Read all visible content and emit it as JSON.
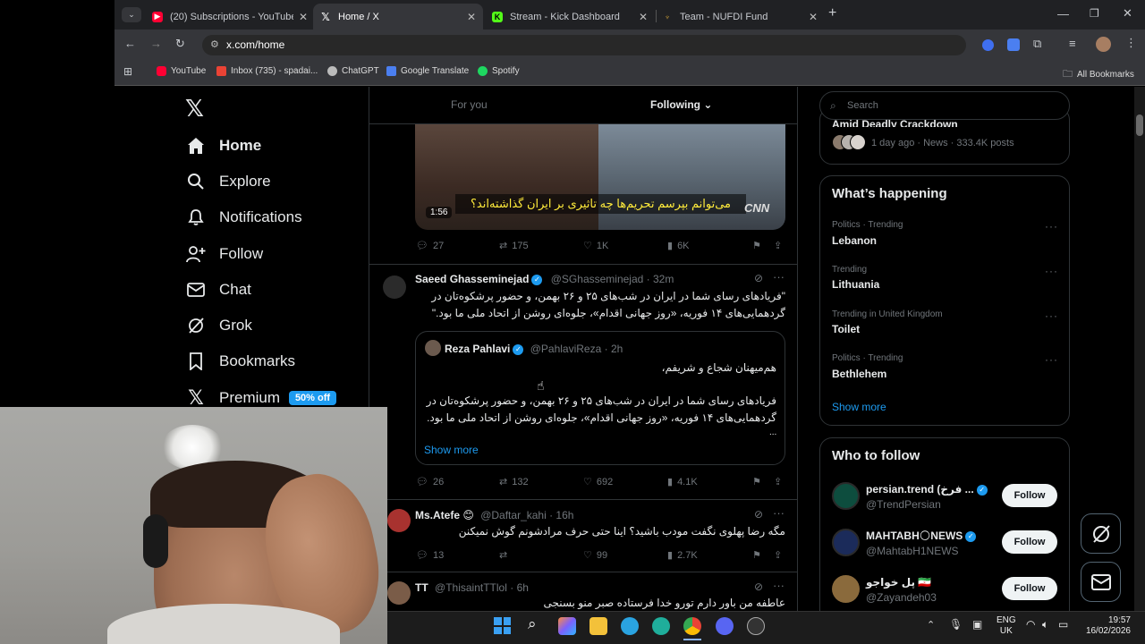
{
  "browser": {
    "tabs": [
      {
        "title": "(20) Subscriptions - YouTube",
        "color": "#ff0033"
      },
      {
        "title": "Home / X",
        "color": "#ffffff"
      },
      {
        "title": "Stream - Kick Dashboard",
        "color": "#53fc18"
      },
      {
        "title": "Team - NUFDI Fund",
        "color": "#c79a36"
      }
    ],
    "url": "x.com/home",
    "bookmarks": [
      "YouTube",
      "Inbox (735) - spadai...",
      "ChatGPT",
      "Google Translate",
      "Spotify"
    ],
    "all_bookmarks": "All Bookmarks"
  },
  "nav": {
    "home": "Home",
    "explore": "Explore",
    "notifications": "Notifications",
    "follow": "Follow",
    "chat": "Chat",
    "grok": "Grok",
    "bookmarks": "Bookmarks",
    "premium": "Premium",
    "premium_badge": "50% off"
  },
  "timeline": {
    "tab_for_you": "For you",
    "tab_following": "Following",
    "video": {
      "duration": "1:56",
      "caption": "می‌توانم بپرسم تحریم‌ها چه تاثیری بر ایران گذاشته‌اند؟",
      "watermark": "CNN"
    },
    "tweet0": {
      "replies": "27",
      "reposts": "175",
      "likes": "1K",
      "views": "6K"
    },
    "tweet1": {
      "name": "Saeed Ghasseminejad",
      "handle": "@SGhasseminejad",
      "time": "· 32m",
      "text_line1": "\"فریادهای رسای شما در ایران در شب‌های ۲۵ و ۲۶ بهمن، و حضور پرشکوه‌تان در",
      "text_line2": "گردهمایی‌های ۱۴ فوریه، «روز جهانی اقدام»، جلوه‌ای روشن از اتحاد ملی ما بود.\"",
      "quote": {
        "name": "Reza Pahlavi",
        "handle": "@PahlaviReza",
        "time": "· 2h",
        "greeting": "هم‌میهنان شجاع و شریفم،",
        "text_line1": "فریادهای رسای شما در ایران در شب‌های ۲۵ و ۲۶ بهمن، و حضور پرشکوه‌تان در",
        "text_line2": "گردهمایی‌های ۱۴ فوریه، «روز جهانی اقدام»، جلوه‌ای روشن از اتحاد ملی ما بود.",
        "ellipsis": "...",
        "show_more": "Show more"
      },
      "replies": "26",
      "reposts": "132",
      "likes": "692",
      "views": "4.1K"
    },
    "tweet2": {
      "name": "Ms.Atefe 😊",
      "handle": "@Daftar_kahi",
      "time": "· 16h",
      "text": "مگه رضا پهلوی نگفت مودب باشید؟ اینا حتی حرف مرادشونم گوش نمیکنن",
      "replies": "13",
      "likes": "99",
      "views": "2.7K"
    },
    "tweet3": {
      "name": "TT",
      "handle": "@ThisaintTTlol",
      "time": "· 6h",
      "text": "عاطفه من باور دارم تورو خدا فرستاده صبر منو بسنجی"
    }
  },
  "right": {
    "search_placeholder": "Search",
    "top_news": {
      "title": "Amid Deadly Crackdown",
      "meta": "1 day ago · News · 333.4K posts"
    },
    "whats_happening": "What’s happening",
    "trends": [
      {
        "category": "Politics · Trending",
        "name": "Lebanon"
      },
      {
        "category": "Trending",
        "name": "Lithuania"
      },
      {
        "category": "Trending in United Kingdom",
        "name": "Toilet"
      },
      {
        "category": "Politics · Trending",
        "name": "Bethlehem"
      }
    ],
    "show_more": "Show more",
    "who_to_follow": "Who to follow",
    "suggestions": [
      {
        "name": "persian.trend (فرخ ...",
        "handle": "@TrendPersian"
      },
      {
        "name": "MAHTABH🌕NEWS",
        "handle": "@MahtabH1NEWS"
      },
      {
        "name": "پل خواجو 🇮🇷",
        "handle": "@Zayandeh03"
      }
    ],
    "follow_label": "Follow"
  },
  "taskbar": {
    "lang_line1": "ENG",
    "lang_line2": "UK",
    "time": "19:57",
    "date": "16/02/2026"
  },
  "colors": {
    "accent": "#1d9bf0",
    "background": "#000000",
    "border": "#2f3336",
    "muted": "#71767b"
  }
}
